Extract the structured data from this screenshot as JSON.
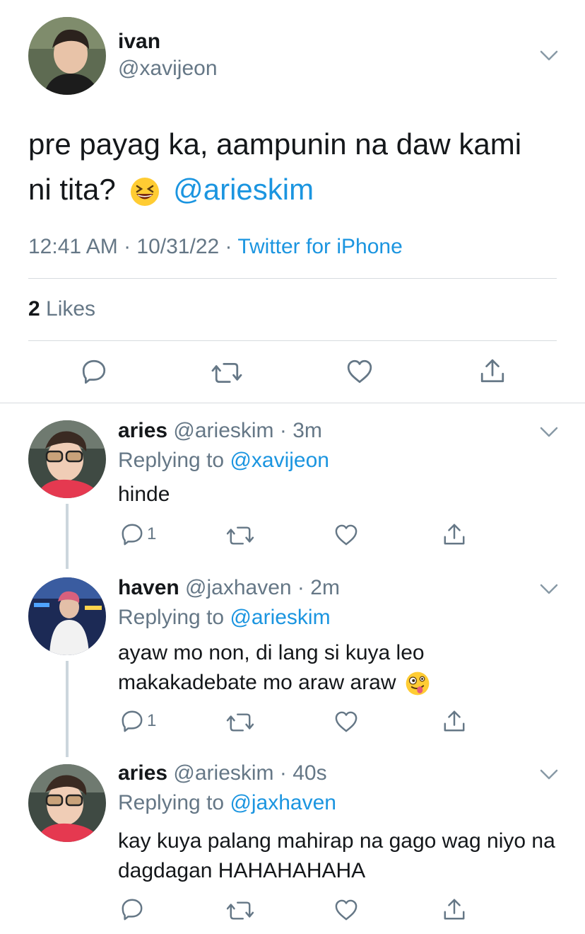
{
  "main_tweet": {
    "name": "ivan",
    "handle": "@xavijeon",
    "text_line1": "pre payag ka, aampunin na daw kami",
    "text_line2": "ni tita?",
    "mention": "@arieskim",
    "time": "12:41 AM · 10/31/22 · ",
    "source": "Twitter for iPhone",
    "likes_count": "2",
    "likes_label": " Likes"
  },
  "replies": [
    {
      "name": "aries",
      "handle": " @arieskim · 3m",
      "replying_prefix": "Replying to ",
      "replying_to": "@xavijeon",
      "text": "hinde",
      "reply_count": "1"
    },
    {
      "name": "haven",
      "handle": " @jaxhaven · 2m",
      "replying_prefix": "Replying to ",
      "replying_to": "@arieskim",
      "text": "ayaw mo non, di lang si kuya leo makakadebate mo araw araw",
      "reply_count": "1"
    },
    {
      "name": "aries",
      "handle": " @arieskim · 40s",
      "replying_prefix": "Replying to ",
      "replying_to": "@jaxhaven",
      "text": "kay kuya palang mahirap na gago wag niyo na dagdagan HAHAHAHAHA",
      "reply_count": ""
    }
  ],
  "colors": {
    "link": "#1b95e0",
    "muted": "#657786",
    "text": "#14171a",
    "divider": "#d7dbdf"
  },
  "icons": [
    "chevron-down-icon",
    "reply-icon",
    "retweet-icon",
    "like-icon",
    "share-icon",
    "grinning-squinting-emoji",
    "zany-face-emoji"
  ]
}
